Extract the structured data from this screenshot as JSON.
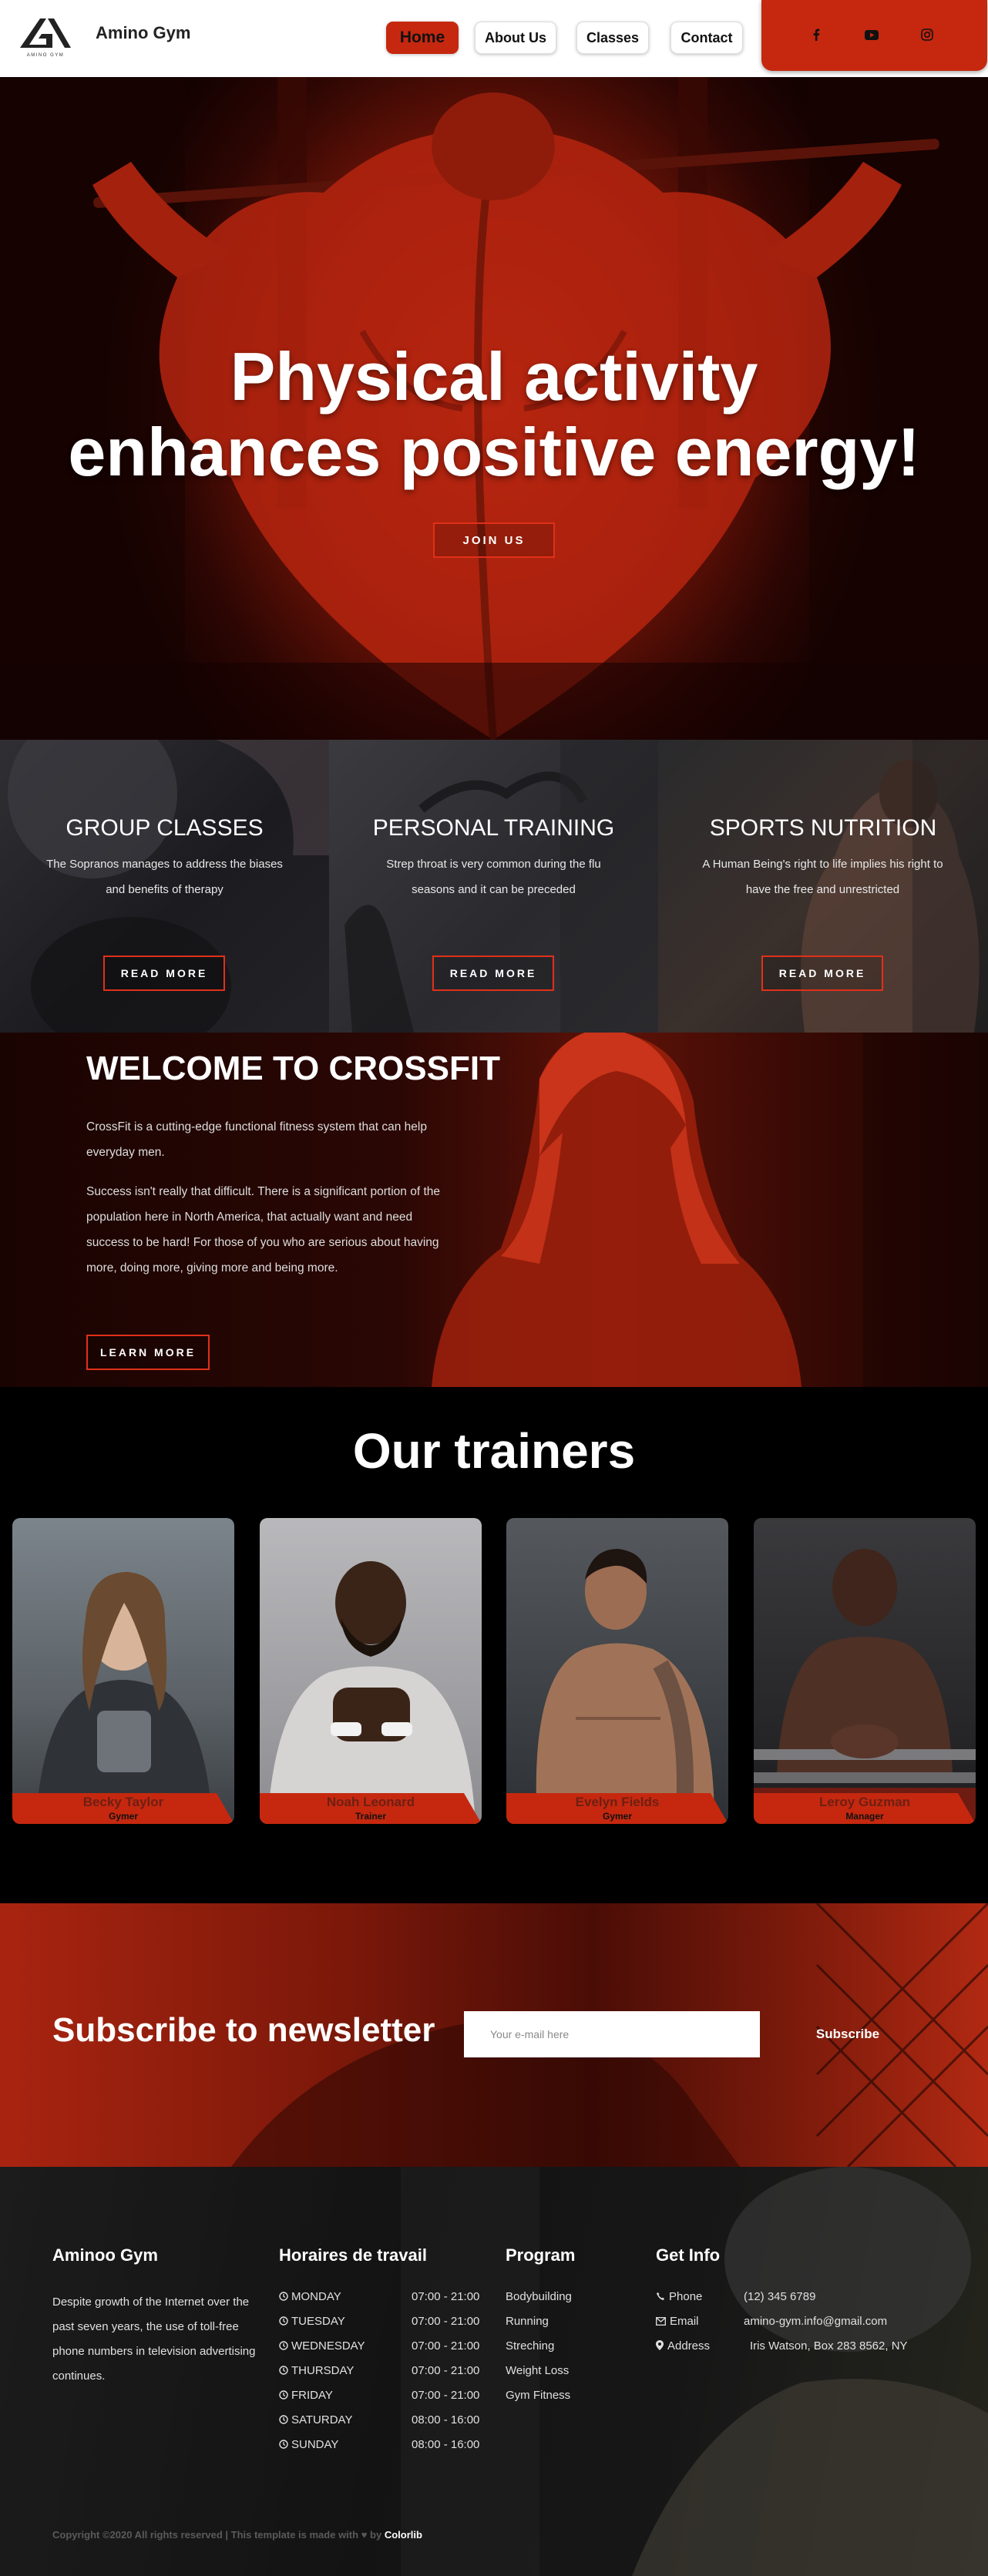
{
  "header": {
    "brand": "Amino Gym",
    "logo_text": "AMINO GYM",
    "nav": [
      {
        "label": "Home",
        "active": true
      },
      {
        "label": "About Us",
        "active": false
      },
      {
        "label": "Classes",
        "active": false
      },
      {
        "label": "Contact",
        "active": false
      }
    ],
    "social_icons": [
      "facebook-icon",
      "youtube-icon",
      "instagram-icon"
    ],
    "accent_color": "#c5280f"
  },
  "hero": {
    "title_line1": "Physical activity",
    "title_line2": "enhances positive energy!",
    "cta": "JOIN US"
  },
  "services": [
    {
      "title": "GROUP CLASSES",
      "text": "The Sopranos manages to address the biases and benefits of therapy",
      "button": "READ MORE"
    },
    {
      "title": "PERSONAL TRAINING",
      "text": "Strep throat is very common during the flu seasons and it can be preceded",
      "button": "READ MORE"
    },
    {
      "title": "SPORTS NUTRITION",
      "text": "A Human Being's right to life implies his right to have the free and unrestricted",
      "button": "READ MORE"
    }
  ],
  "welcome": {
    "title": "WELCOME TO CROSSFIT",
    "p1": "CrossFit is a cutting-edge functional fitness system that can help everyday men.",
    "p2": "Success isn't really that difficult. There is a significant portion of the population here in North America, that actually want and need success to be hard! For those of you who are serious about having more, doing more, giving more and being more.",
    "button": "LEARN MORE"
  },
  "trainers": {
    "title": "Our trainers",
    "items": [
      {
        "name": "Becky Taylor",
        "role": "Gymer"
      },
      {
        "name": "Noah Leonard",
        "role": "Trainer"
      },
      {
        "name": "Evelyn Fields",
        "role": "Gymer"
      },
      {
        "name": "Leroy Guzman",
        "role": "Manager"
      }
    ]
  },
  "newsletter": {
    "title": "Subscribe to newsletter",
    "placeholder": "Your e-mail here",
    "button": "Subscribe"
  },
  "footer": {
    "about_title": "Aminoo Gym",
    "about_text": "Despite growth of the Internet over the past seven years, the use of toll-free phone numbers in television advertising continues.",
    "hours_title": "Horaires de travail",
    "hours": [
      {
        "day": "MONDAY",
        "time": "07:00 - 21:00"
      },
      {
        "day": "TUESDAY",
        "time": "07:00 - 21:00"
      },
      {
        "day": "WEDNESDAY",
        "time": "07:00 - 21:00"
      },
      {
        "day": "THURSDAY",
        "time": "07:00 - 21:00"
      },
      {
        "day": "FRIDAY",
        "time": "07:00 - 21:00"
      },
      {
        "day": "SATURDAY",
        "time": "08:00 - 16:00"
      },
      {
        "day": "SUNDAY",
        "time": "08:00 - 16:00"
      }
    ],
    "program_title": "Program",
    "programs": [
      "Bodybuilding",
      "Running",
      "Streching",
      "Weight Loss",
      "Gym Fitness"
    ],
    "info_title": "Get Info",
    "info": [
      {
        "label": "Phone",
        "value": "(12) 345 6789"
      },
      {
        "label": "Email",
        "value": "amino-gym.info@gmail.com"
      },
      {
        "label": "Address",
        "value": "Iris Watson, Box 283 8562, NY"
      }
    ],
    "copyright": "Copyright ©2020 All rights reserved | This template is made with",
    "by": "by",
    "credit": "Colorlib"
  }
}
